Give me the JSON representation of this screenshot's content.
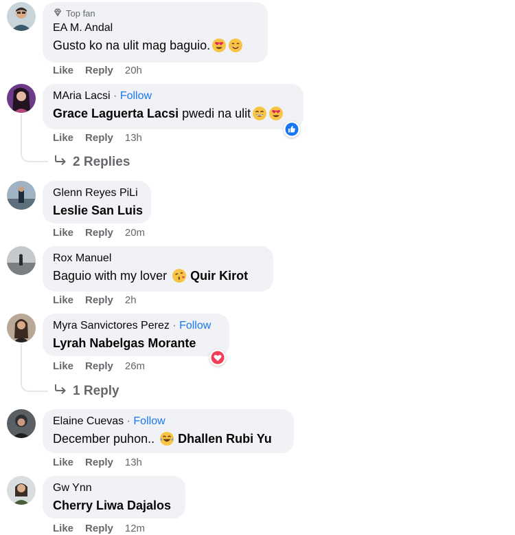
{
  "comments": [
    {
      "badge": "Top fan",
      "name": "EA M. Andal",
      "text": "Gusto ko na ulit mag baguio.",
      "tag": "",
      "emojis": [
        "heart-eyes-emoji",
        "smile-emoji"
      ],
      "actions": {
        "like": "Like",
        "reply": "Reply",
        "time": "20h"
      }
    },
    {
      "name": "MAria Lacsi",
      "separator": "·",
      "follow": "Follow",
      "tag": "Grace Laguerta Lacsi",
      "text": " pwedi na ulit",
      "emojis": [
        "grin-emoji",
        "heart-eyes-emoji"
      ],
      "reaction": "like-reaction-icon",
      "actions": {
        "like": "Like",
        "reply": "Reply",
        "time": "13h"
      },
      "replies": "2 Replies"
    },
    {
      "name": "Glenn Reyes PiLi",
      "tag": "Leslie San Luis",
      "text": "",
      "actions": {
        "like": "Like",
        "reply": "Reply",
        "time": "20m"
      }
    },
    {
      "name": "Rox Manuel",
      "text": "Baguio with my lover ",
      "emojis": [
        "kiss-emoji"
      ],
      "tag": "Quir Kirot",
      "actions": {
        "like": "Like",
        "reply": "Reply",
        "time": "2h"
      }
    },
    {
      "name": "Myra Sanvictores Perez",
      "separator": "·",
      "follow": "Follow",
      "tag": "Lyrah Nabelgas Morante",
      "text": "",
      "reaction": "love-reaction-icon",
      "actions": {
        "like": "Like",
        "reply": "Reply",
        "time": "26m"
      },
      "replies": "1 Reply"
    },
    {
      "name": "Elaine Cuevas",
      "separator": "·",
      "follow": "Follow",
      "text": "December puhon.. ",
      "emojis": [
        "laugh-tears-emoji"
      ],
      "tag": "Dhallen Rubi Yu",
      "actions": {
        "like": "Like",
        "reply": "Reply",
        "time": "13h"
      }
    },
    {
      "name": "Gw Ynn",
      "tag": "Cherry Liwa Dajalos",
      "text": "",
      "actions": {
        "like": "Like",
        "reply": "Reply",
        "time": "12m"
      }
    }
  ]
}
